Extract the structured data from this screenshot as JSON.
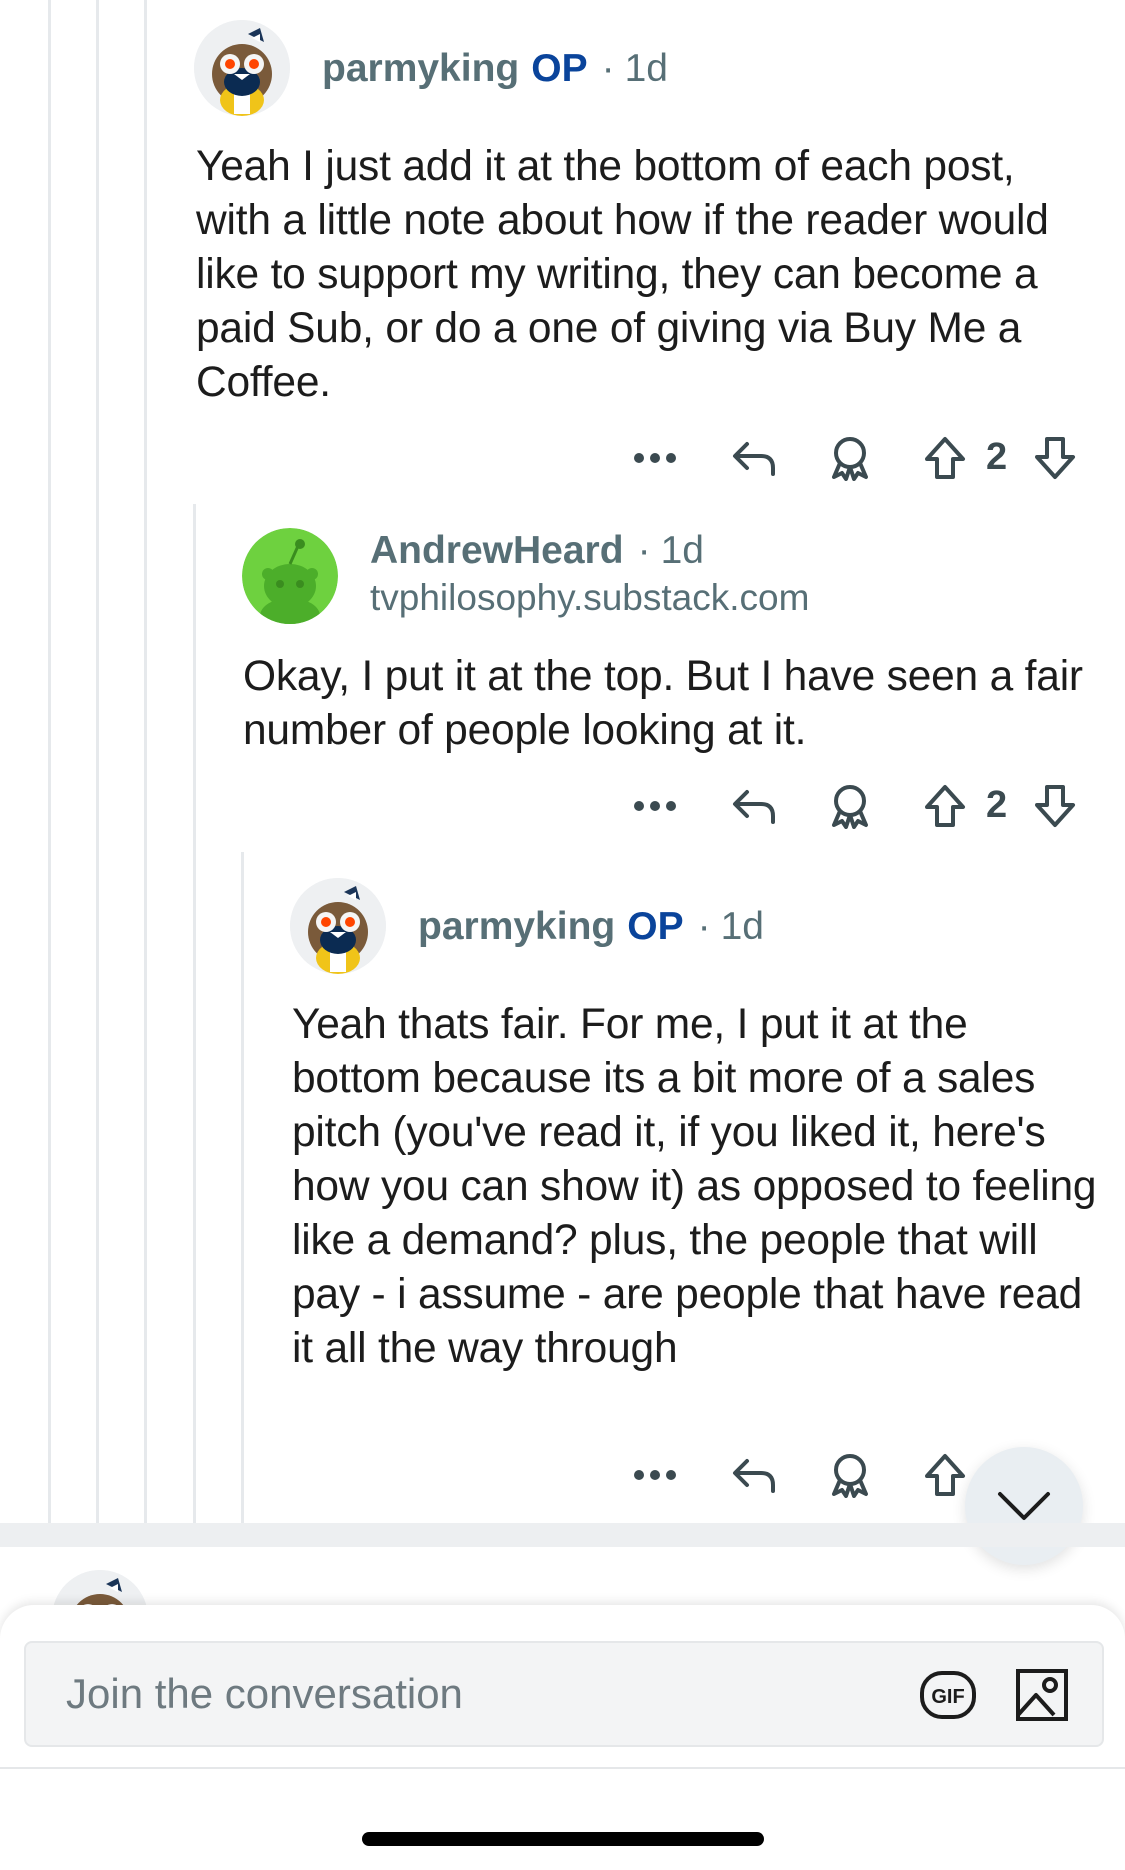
{
  "comments": [
    {
      "username": "parmyking",
      "op_badge": "OP",
      "separator": "·",
      "age": "1d",
      "avatar_icon": "snoo-owl-avatar-icon",
      "body": "Yeah I just add it at the bottom of each post, with a little note about how if the reader would like to support my writing, they can become a paid Sub, or do a one of giving via Buy Me a Coffee.",
      "votes": "2"
    },
    {
      "username": "AndrewHeard",
      "separator": "·",
      "age": "1d",
      "flair": "tvphilosophy.substack.com",
      "avatar_icon": "green-snoo-avatar-icon",
      "body": "Okay, I put it at the top. But I have seen a fair number of people looking at it.",
      "votes": "2"
    },
    {
      "username": "parmyking",
      "op_badge": "OP",
      "separator": "·",
      "age": "1d",
      "avatar_icon": "snoo-owl-avatar-icon",
      "body": "Yeah thats fair. For me, I put it at the bottom because its a bit more of a sales pitch (you've read it, if you liked it, here's how you can show it) as opposed to feeling like a demand? plus, the people that will pay - i assume - are people that have read it all the way through"
    }
  ],
  "composer": {
    "placeholder": "Join the conversation",
    "gif_label": "GIF"
  },
  "colors": {
    "op_blue": "#0a449b",
    "meta_gray": "#576f76",
    "green_avatar": "#6ed13f"
  }
}
